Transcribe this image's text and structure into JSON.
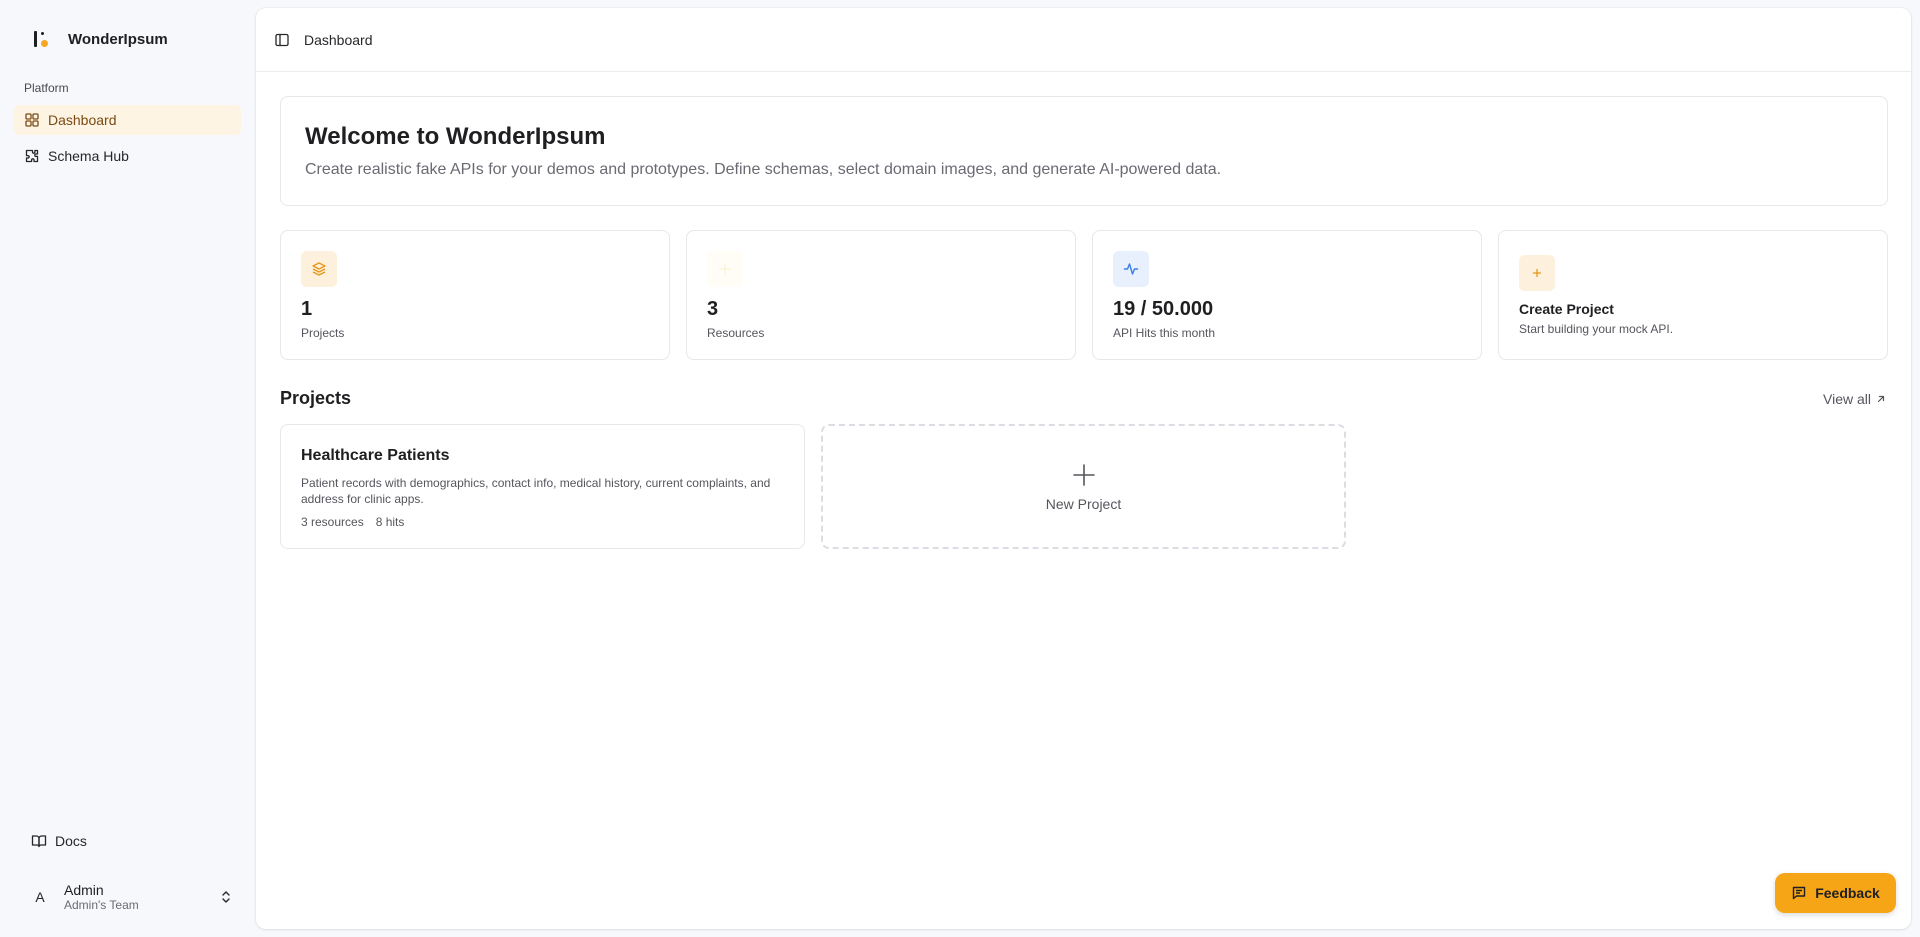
{
  "brand": {
    "name": "WonderIpsum"
  },
  "sidebar": {
    "group_label": "Platform",
    "items": [
      {
        "label": "Dashboard",
        "icon": "grid-icon",
        "active": true
      },
      {
        "label": "Schema Hub",
        "icon": "puzzle-icon",
        "active": false
      }
    ],
    "docs_label": "Docs",
    "user": {
      "initial": "A",
      "name": "Admin",
      "team": "Admin's Team"
    }
  },
  "topbar": {
    "title": "Dashboard"
  },
  "welcome": {
    "title": "Welcome to WonderIpsum",
    "subtitle": "Create realistic fake APIs for your demos and prototypes. Define schemas, select domain images, and generate AI-powered data."
  },
  "stats": [
    {
      "value": "1",
      "label": "Projects",
      "icon": "layers-icon"
    },
    {
      "value": "3",
      "label": "Resources",
      "icon": "sparkle-icon"
    },
    {
      "value": "19 / 50.000",
      "label": "API Hits this month",
      "icon": "activity-icon"
    }
  ],
  "create_card": {
    "title": "Create Project",
    "subtitle": "Start building your mock API."
  },
  "projects_section": {
    "title": "Projects",
    "view_all": "View all"
  },
  "projects": [
    {
      "name": "Healthcare Patients",
      "description": "Patient records with demographics, contact info, medical history, current complaints, and address for clinic apps.",
      "resources": "3 resources",
      "hits": "8 hits"
    }
  ],
  "new_project_label": "New Project",
  "feedback_label": "Feedback",
  "colors": {
    "accent": "#f5a515",
    "active_bg": "#fdf4e3",
    "blue_icon_bg": "#e8f0fe"
  }
}
